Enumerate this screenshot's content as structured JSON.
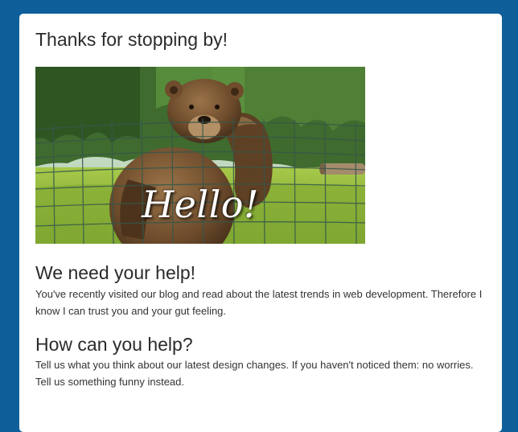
{
  "page": {
    "title": "Thanks for stopping by!"
  },
  "hero": {
    "caption": "Hello!",
    "subject": "waving bear behind wire fence"
  },
  "sections": [
    {
      "heading": "We need your help!",
      "body": "You've recently visited our blog and read about the latest trends in web development. Therefore I know I can trust you and your gut feeling."
    },
    {
      "heading": "How can you help?",
      "body": "Tell us what you think about our latest design changes. If you haven't noticed them: no worries. Tell us something funny instead."
    }
  ],
  "colors": {
    "background": "#0e5f99",
    "card": "#ffffff",
    "text": "#2b2b2b"
  }
}
